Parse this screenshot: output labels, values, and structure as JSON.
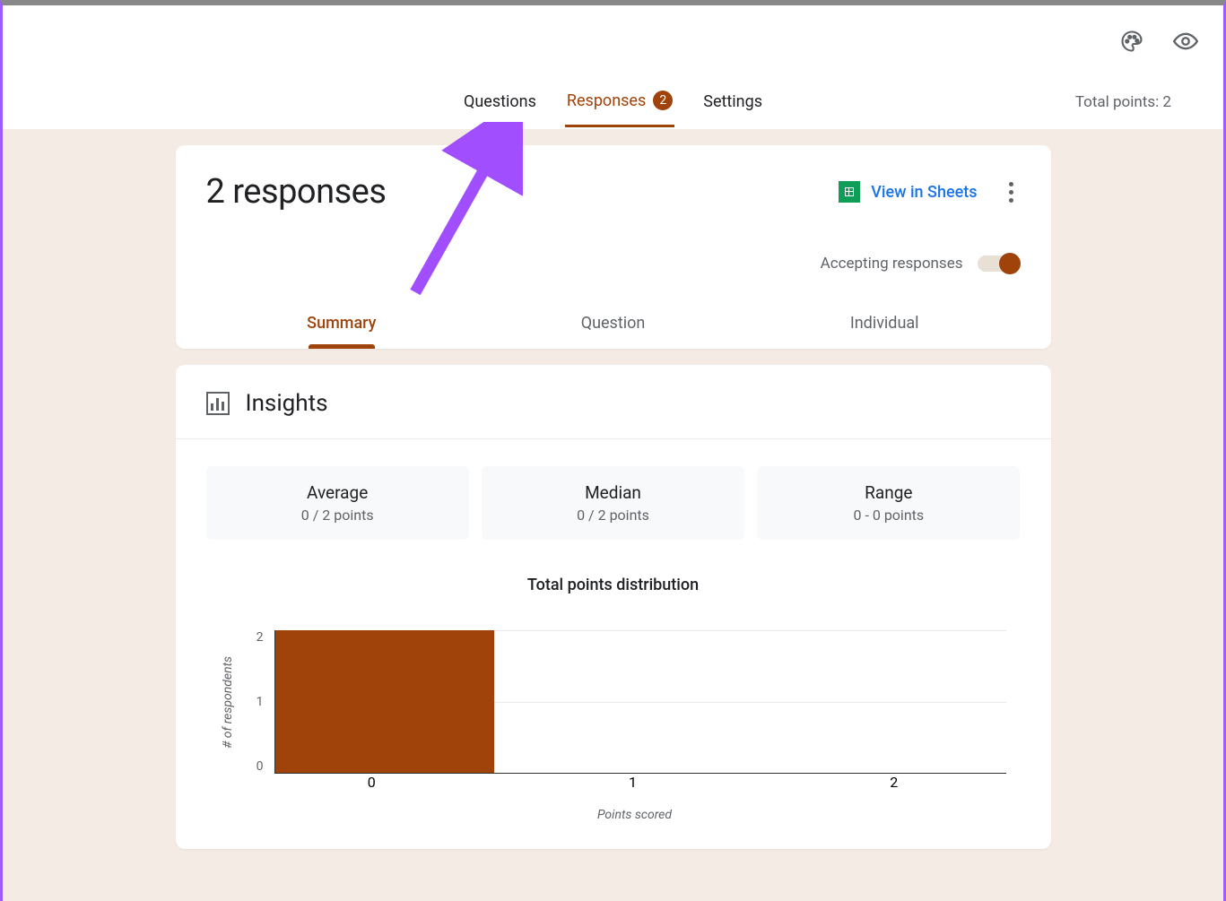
{
  "header": {
    "tabs": {
      "questions": "Questions",
      "responses": "Responses",
      "settings": "Settings",
      "responses_badge": "2"
    },
    "total_points": "Total points: 2"
  },
  "responses_card": {
    "title": "2 responses",
    "view_in_sheets": "View in Sheets",
    "accepting_label": "Accepting responses",
    "sub_tabs": {
      "summary": "Summary",
      "question": "Question",
      "individual": "Individual"
    }
  },
  "insights": {
    "title": "Insights",
    "stats": {
      "average_label": "Average",
      "average_value": "0 / 2 points",
      "median_label": "Median",
      "median_value": "0 / 2 points",
      "range_label": "Range",
      "range_value": "0 - 0 points"
    },
    "chart_title": "Total points distribution",
    "xlabel": "Points scored",
    "ylabel": "# of respondents",
    "y_ticks": {
      "t0": "0",
      "t1": "1",
      "t2": "2"
    },
    "x_ticks": {
      "t0": "0",
      "t1": "1",
      "t2": "2"
    }
  },
  "chart_data": {
    "type": "bar",
    "title": "Total points distribution",
    "categories": [
      "0",
      "1",
      "2"
    ],
    "values": [
      2,
      0,
      0
    ],
    "xlabel": "Points scored",
    "ylabel": "# of respondents",
    "ylim": [
      0,
      2
    ]
  }
}
